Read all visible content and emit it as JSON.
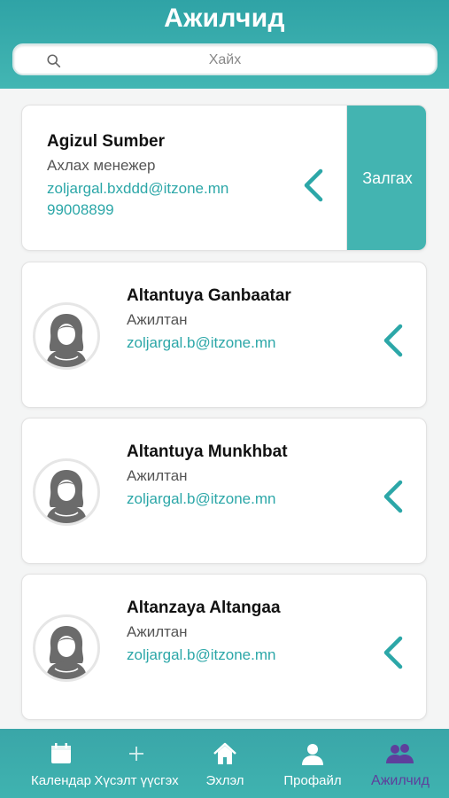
{
  "header": {
    "title": "Ажилчид"
  },
  "search": {
    "placeholder": "Хайх"
  },
  "employees": [
    {
      "name": "Agizul Sumber",
      "role": "Ахлах менежер",
      "email": "zoljargal.bxddd@itzone.mn",
      "phone": "99008899",
      "action_label": "Залгах"
    },
    {
      "name": "Altantuya Ganbaatar",
      "role": "Ажилтан",
      "email": "zoljargal.b@itzone.mn"
    },
    {
      "name": "Altantuya Munkhbat",
      "role": "Ажилтан",
      "email": "zoljargal.b@itzone.mn"
    },
    {
      "name": "Altanzaya Altangaa",
      "role": "Ажилтан",
      "email": "zoljargal.b@itzone.mn"
    }
  ],
  "tabs": [
    {
      "label": "Календар",
      "icon": "calendar-icon"
    },
    {
      "label": "Хүсэлт үүсгэх",
      "icon": "plus-icon"
    },
    {
      "label": "Эхлэл",
      "icon": "home-icon"
    },
    {
      "label": "Профайл",
      "icon": "user-icon"
    },
    {
      "label": "Ажилчид",
      "icon": "users-icon",
      "active": true
    }
  ],
  "colors": {
    "accent": "#43b4b1",
    "active_tab": "#5e3f9c"
  }
}
